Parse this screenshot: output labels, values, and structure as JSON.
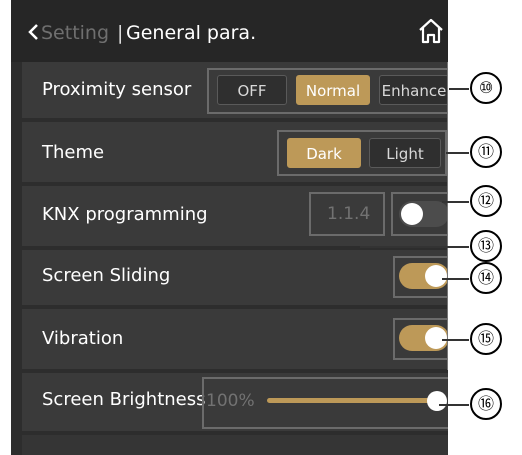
{
  "header": {
    "back_label": "Setting",
    "separator": "|",
    "title": "General para."
  },
  "rows": {
    "proximity": {
      "label": "Proximity sensor",
      "options": [
        "OFF",
        "Normal",
        "Enhance"
      ],
      "selected": "Normal"
    },
    "theme": {
      "label": "Theme",
      "options": [
        "Dark",
        "Light"
      ],
      "selected": "Dark"
    },
    "knx": {
      "label": "KNX programming",
      "address": "1.1.4",
      "enabled": false
    },
    "screen_sliding": {
      "label": "Screen Sliding",
      "enabled": true
    },
    "vibration": {
      "label": "Vibration",
      "enabled": true
    },
    "brightness": {
      "label": "Screen Brightness",
      "value": "100%",
      "level": 1.0
    }
  },
  "callouts": [
    "⑩",
    "⑪",
    "⑫",
    "⑬",
    "⑭",
    "⑮",
    "⑯"
  ],
  "colors": {
    "accent": "#bd9958",
    "background": "#2d2d2d",
    "row": "#3a3a3a"
  }
}
